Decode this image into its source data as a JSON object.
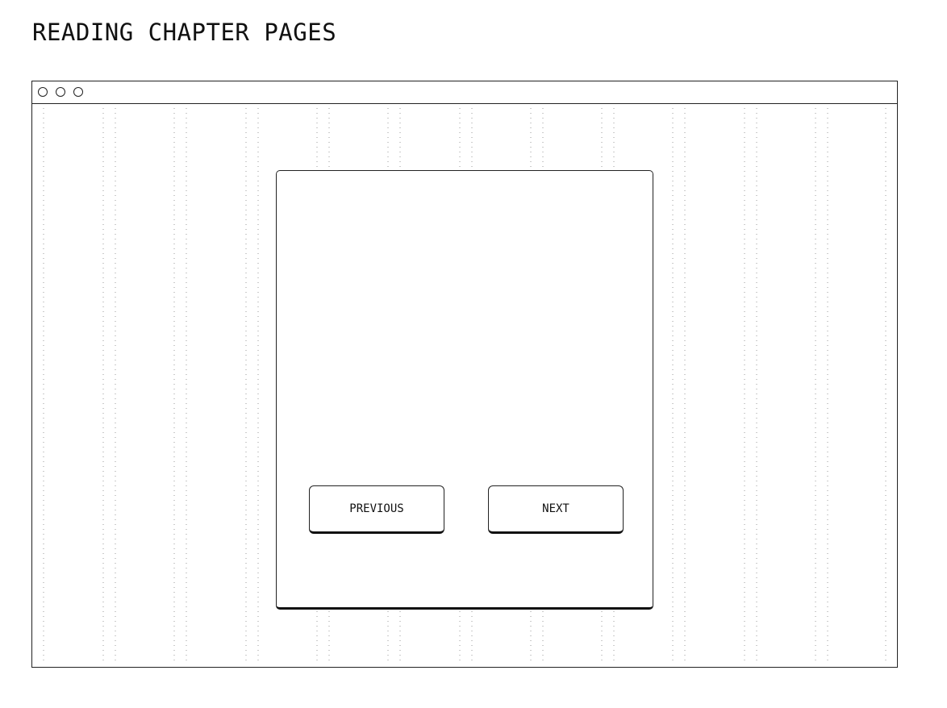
{
  "page": {
    "title": "READING CHAPTER PAGES"
  },
  "window": {
    "controls": [
      "window-control-1",
      "window-control-2",
      "window-control-3"
    ]
  },
  "reader": {
    "previous_label": "PREVIOUS",
    "next_label": "NEXT"
  },
  "colors": {
    "background": "#ffffff",
    "stroke": "#222222",
    "grid_dots": "#9a9a9a"
  }
}
